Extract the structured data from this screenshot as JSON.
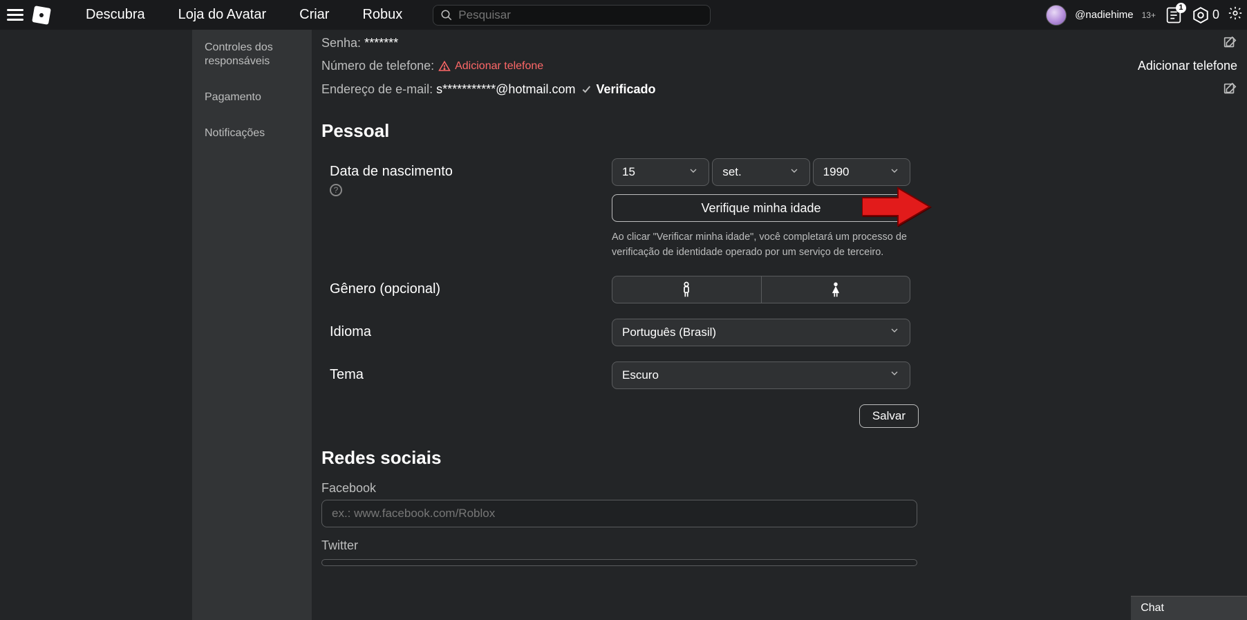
{
  "nav": {
    "descubra": "Descubra",
    "loja": "Loja do Avatar",
    "criar": "Criar",
    "robux": "Robux",
    "search_placeholder": "Pesquisar"
  },
  "user": {
    "name": "@nadiehime",
    "age_tag": "13+",
    "notif_count": "1",
    "robux": "0"
  },
  "sidebar": {
    "controles": "Controles dos responsáveis",
    "pagamento": "Pagamento",
    "notificacoes": "Notificações"
  },
  "account": {
    "senha_label": "Senha:",
    "senha_value": "*******",
    "numero_label": "Número de telefone:",
    "numero_warn": "Adicionar telefone",
    "numero_action": "Adicionar telefone",
    "email_label": "Endereço de e-mail:",
    "email_value": "s***********@hotmail.com",
    "email_verified": "Verificado"
  },
  "pessoal": {
    "heading": "Pessoal",
    "dob_label": "Data de nascimento",
    "dob_day": "15",
    "dob_month": "set.",
    "dob_year": "1990",
    "verify_button": "Verifique minha idade",
    "verify_note": "Ao clicar \"Verificar minha idade\", você completará um processo de verificação de identidade operado por um serviço de terceiro.",
    "genero_label": "Gênero (opcional)",
    "idioma_label": "Idioma",
    "idioma_value": "Português (Brasil)",
    "tema_label": "Tema",
    "tema_value": "Escuro",
    "save": "Salvar"
  },
  "social": {
    "heading": "Redes sociais",
    "facebook_label": "Facebook",
    "facebook_placeholder": "ex.: www.facebook.com/Roblox",
    "twitter_label": "Twitter"
  },
  "chat": {
    "label": "Chat"
  }
}
